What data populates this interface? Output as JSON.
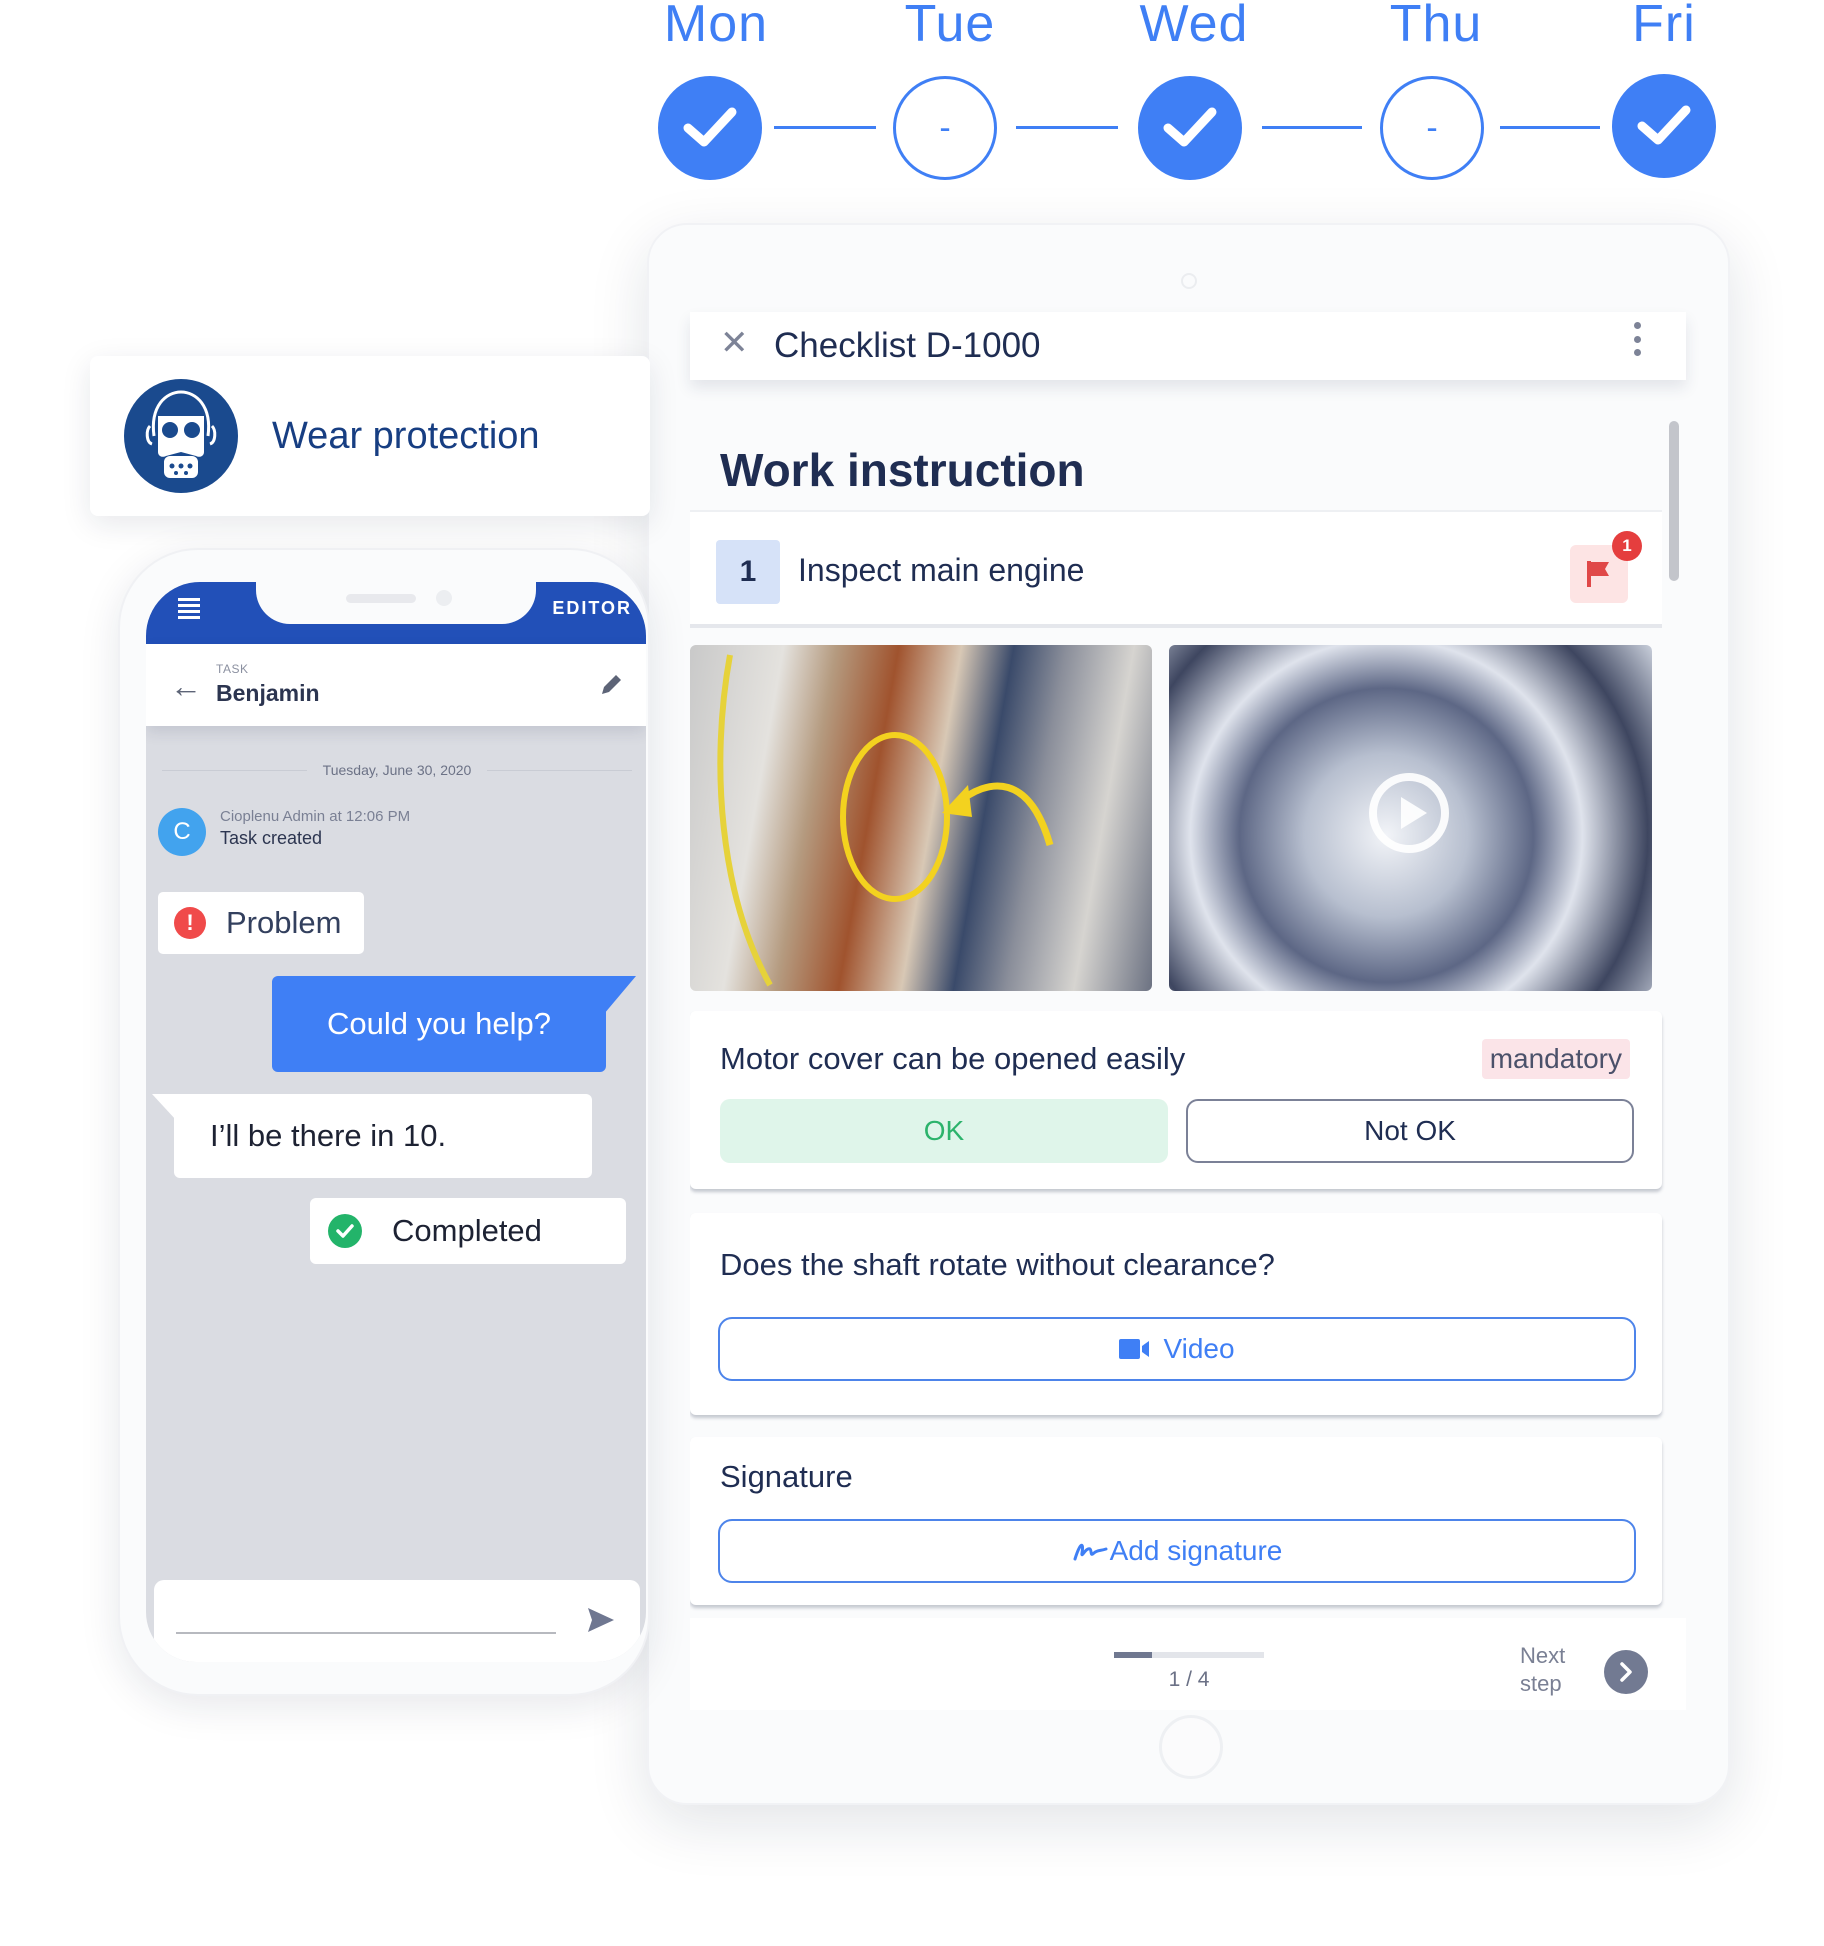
{
  "week": {
    "days": [
      {
        "label": "Mon",
        "status": "done",
        "symbol": "check-icon"
      },
      {
        "label": "Tue",
        "status": "pending",
        "symbol": "-"
      },
      {
        "label": "Wed",
        "status": "done",
        "symbol": "check-icon"
      },
      {
        "label": "Thu",
        "status": "pending",
        "symbol": "-"
      },
      {
        "label": "Fri",
        "status": "done",
        "symbol": "check-icon"
      }
    ],
    "accent": "#3f7ff5"
  },
  "safety_card": {
    "icon": "respirator-mask-icon",
    "label": "Wear protection",
    "color": "#1a4a8e"
  },
  "phone": {
    "topbar": {
      "menu_icon": "hamburger-menu-icon",
      "mode_label": "EDITOR",
      "color": "#2250b8"
    },
    "task_header": {
      "overline": "TASK",
      "name": "Benjamin",
      "back_icon": "arrow-left-icon",
      "edit_icon": "pencil-icon"
    },
    "chat": {
      "date": "Tuesday, June 30, 2020",
      "system_event": {
        "avatar": "C",
        "meta": "Cioplenu Admin at 12:06 PM",
        "text": "Task created"
      },
      "messages": [
        {
          "type": "status",
          "icon": "exclamation-icon",
          "text": "Problem",
          "color": "#f04a4a"
        },
        {
          "type": "outgoing",
          "text": "Could you help?"
        },
        {
          "type": "incoming",
          "text": "I’ll be there in 10."
        },
        {
          "type": "status",
          "icon": "check-circle-icon",
          "text": "Completed",
          "color": "#23b46a"
        }
      ],
      "input": {
        "value": "",
        "placeholder": "",
        "send_icon": "send-icon"
      }
    }
  },
  "tablet": {
    "header": {
      "close_icon": "close-icon",
      "title": "Checklist D-1000",
      "menu_icon": "more-vertical-icon"
    },
    "section_title": "Work instruction",
    "step": {
      "number": "1",
      "label": "Inspect main engine",
      "flag_count": "1",
      "flag_color": "#e53e3e"
    },
    "media": [
      {
        "kind": "image",
        "alt": "Engine stator with highlighted winding"
      },
      {
        "kind": "video",
        "alt": "Gear mechanism",
        "play_icon": "play-icon"
      }
    ],
    "checks": [
      {
        "question": "Motor cover can be opened easily",
        "badge": "mandatory",
        "options": [
          "OK",
          "Not OK"
        ],
        "selected": "OK"
      },
      {
        "question": "Does the shaft rotate without clearance?",
        "action": {
          "icon": "video-camera-icon",
          "label": "Video"
        }
      },
      {
        "question": "Signature",
        "action": {
          "icon": "signature-icon",
          "label": "Add signature"
        }
      }
    ],
    "footer": {
      "progress_text": "1 / 4",
      "progress_fraction": 0.25,
      "next_label_line1": "Next",
      "next_label_line2": "step",
      "next_icon": "chevron-right-icon"
    }
  }
}
